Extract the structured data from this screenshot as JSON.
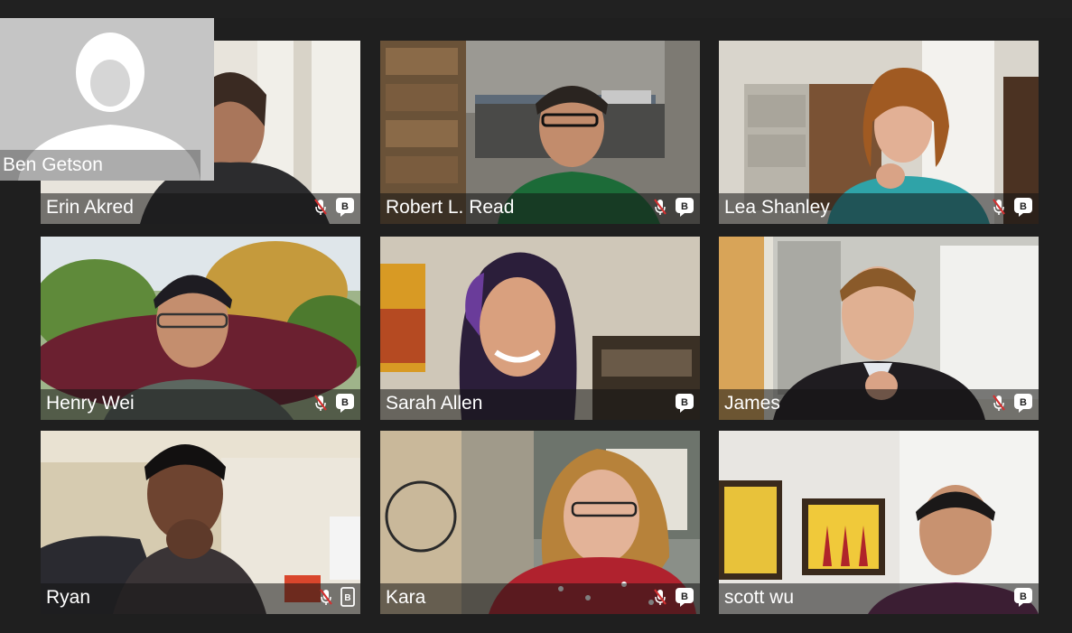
{
  "participants": [
    {
      "name": "Erin Akred",
      "muted": true,
      "badge": "B"
    },
    {
      "name": "Robert L. Read",
      "muted": true,
      "badge": "B"
    },
    {
      "name": "Lea Shanley",
      "muted": true,
      "badge": "B"
    },
    {
      "name": "Henry Wei",
      "muted": true,
      "badge": "B"
    },
    {
      "name": "Sarah Allen",
      "muted": false,
      "badge": "B"
    },
    {
      "name": "James",
      "muted": true,
      "badge": "B"
    },
    {
      "name": "Ryan",
      "muted": true,
      "badge": "B",
      "device": "tablet"
    },
    {
      "name": "Kara",
      "muted": true,
      "badge": "B"
    },
    {
      "name": "scott wu",
      "muted": false,
      "badge": "B"
    }
  ],
  "self_view": {
    "name": "Ben Getson"
  },
  "colors": {
    "background": "#1f1f1f",
    "caption_overlay": "rgba(20,20,20,0.55)",
    "mute_slash": "#d33030",
    "text": "#ffffff"
  },
  "icons": {
    "mute": "microphone-muted-icon",
    "badge": "hangouts-badge-icon",
    "tablet": "tablet-device-icon"
  }
}
